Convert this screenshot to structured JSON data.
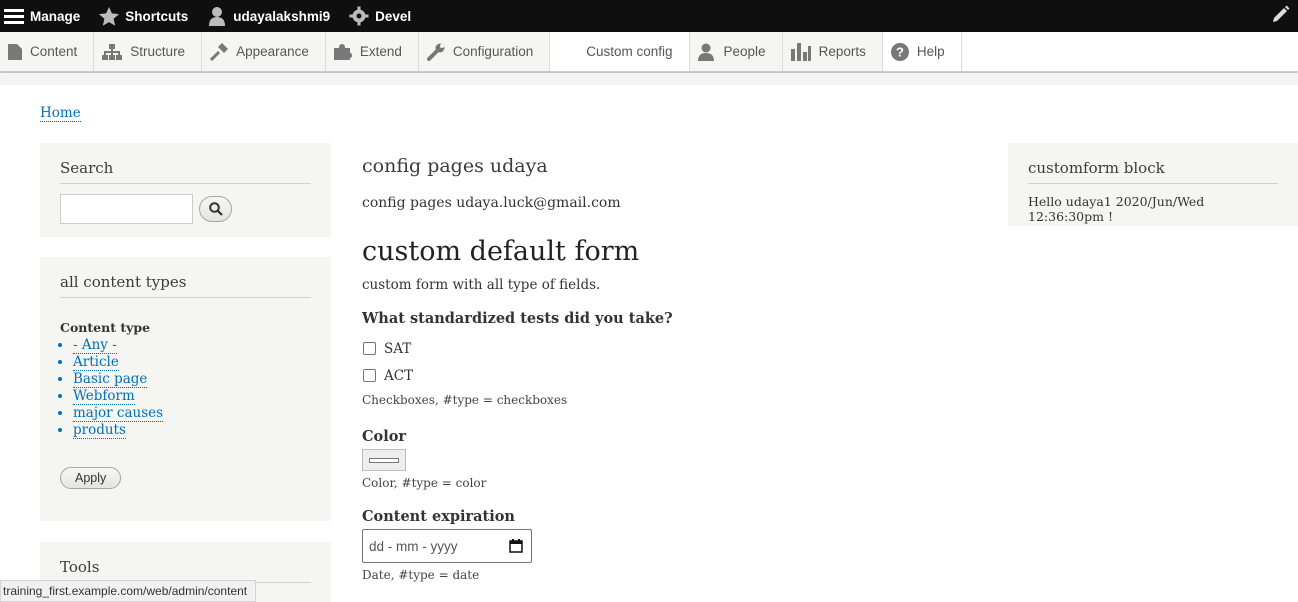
{
  "toolbar": {
    "items": [
      {
        "label": "Manage",
        "icon": "hamburger-icon"
      },
      {
        "label": "Shortcuts",
        "icon": "star-icon"
      },
      {
        "label": "udayalakshmi9",
        "icon": "user-icon"
      },
      {
        "label": "Devel",
        "icon": "gear-icon"
      }
    ],
    "edit_icon": "pencil-icon"
  },
  "tray": {
    "items": [
      {
        "label": "Content",
        "icon": "file-icon"
      },
      {
        "label": "Structure",
        "icon": "structure-icon"
      },
      {
        "label": "Appearance",
        "icon": "brush-icon"
      },
      {
        "label": "Extend",
        "icon": "puzzle-icon"
      },
      {
        "label": "Configuration",
        "icon": "wrench-icon"
      },
      {
        "label": "Custom config",
        "icon": ""
      },
      {
        "label": "People",
        "icon": "people-icon"
      },
      {
        "label": "Reports",
        "icon": "bar-chart-icon"
      },
      {
        "label": "Help",
        "icon": "help-icon"
      }
    ]
  },
  "breadcrumb": {
    "home": "Home"
  },
  "search_block": {
    "title": "Search",
    "input_value": ""
  },
  "content_types_block": {
    "title": "all content types",
    "label": "Content type",
    "options": [
      "- Any -",
      "Article",
      "Basic page",
      "Webform",
      "major causes",
      "produts"
    ],
    "apply": "Apply"
  },
  "tools_block": {
    "title": "Tools"
  },
  "main": {
    "config_title": "config pages udaya",
    "config_text": "config pages udaya.luck@gmail.com",
    "form_title": "custom default form",
    "form_desc": "custom form with all type of fields.",
    "tests": {
      "title": "What standardized tests did you take?",
      "options": [
        "SAT",
        "ACT"
      ],
      "desc": "Checkboxes, #type = checkboxes"
    },
    "color": {
      "title": "Color",
      "desc": "Color, #type = color"
    },
    "expiration": {
      "title": "Content expiration",
      "placeholder": "dd - mm - yyyy",
      "desc": "Date, #type = date"
    }
  },
  "custom_block": {
    "title": "customform block",
    "text": "Hello udaya1 2020/Jun/Wed 12:36:30pm !"
  },
  "status_url": "training_first.example.com/web/admin/content"
}
